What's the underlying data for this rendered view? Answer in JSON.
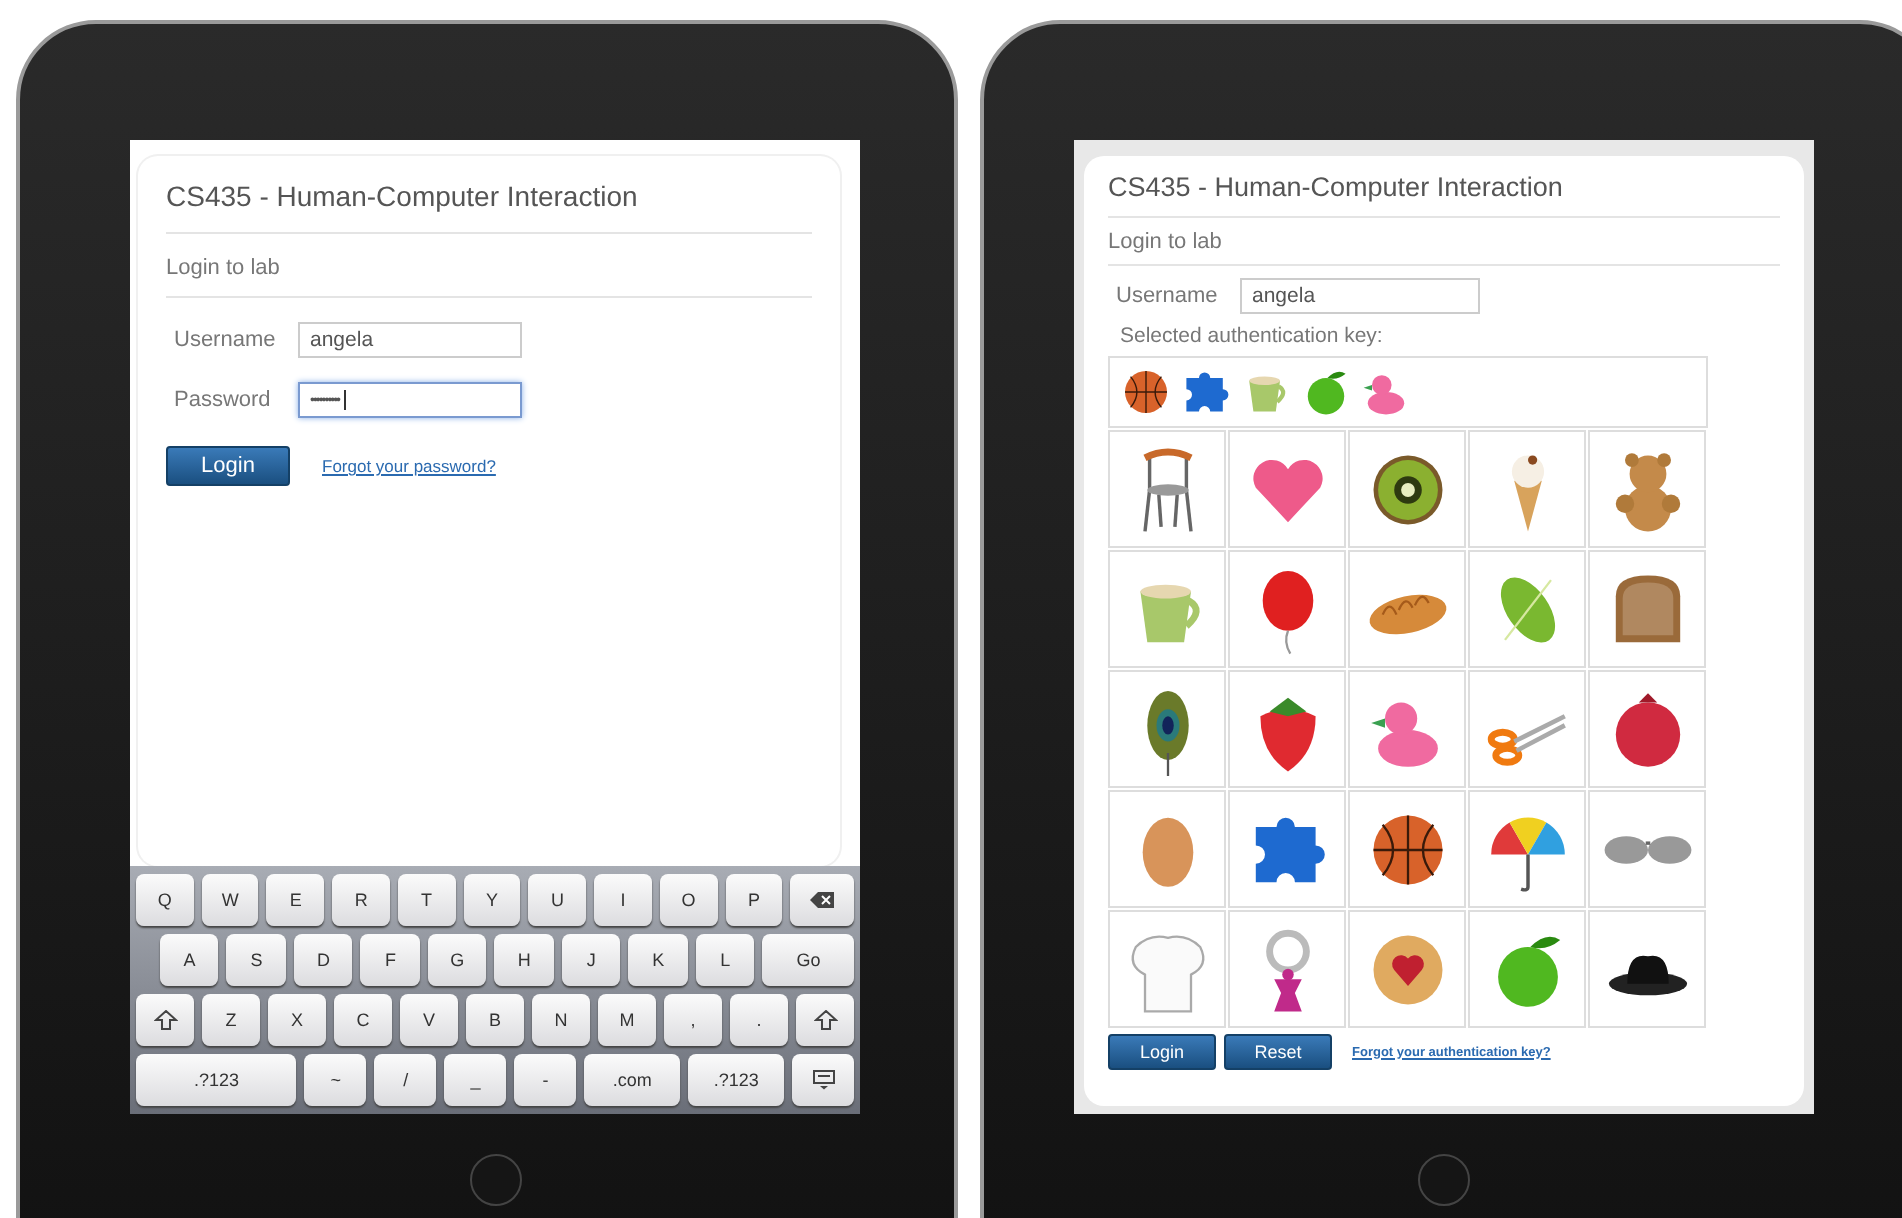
{
  "left_ipad": {
    "course_title": "CS435 - Human-Computer Interaction",
    "section_title": "Login to lab",
    "username": {
      "label": "Username",
      "value": "angela",
      "focused": false
    },
    "password": {
      "label": "Password",
      "value": "••••••••••",
      "focused": true
    },
    "login_button": "Login",
    "forgot_link": "Forgot your password?",
    "keyboard": [
      [
        {
          "kind": "key",
          "label": "Q"
        },
        {
          "kind": "key",
          "label": "W"
        },
        {
          "kind": "key",
          "label": "E"
        },
        {
          "kind": "key",
          "label": "R"
        },
        {
          "kind": "key",
          "label": "T"
        },
        {
          "kind": "key",
          "label": "Y"
        },
        {
          "kind": "key",
          "label": "U"
        },
        {
          "kind": "key",
          "label": "I"
        },
        {
          "kind": "key",
          "label": "O"
        },
        {
          "kind": "key",
          "label": "P"
        },
        {
          "kind": "backspace"
        }
      ],
      [
        {
          "kind": "key",
          "label": "A"
        },
        {
          "kind": "key",
          "label": "S"
        },
        {
          "kind": "key",
          "label": "D"
        },
        {
          "kind": "key",
          "label": "F"
        },
        {
          "kind": "key",
          "label": "G"
        },
        {
          "kind": "key",
          "label": "H"
        },
        {
          "kind": "key",
          "label": "J"
        },
        {
          "kind": "key",
          "label": "K"
        },
        {
          "kind": "key",
          "label": "L"
        },
        {
          "kind": "wide",
          "label": "Go"
        }
      ],
      [
        {
          "kind": "shift"
        },
        {
          "kind": "key",
          "label": "Z"
        },
        {
          "kind": "key",
          "label": "X"
        },
        {
          "kind": "key",
          "label": "C"
        },
        {
          "kind": "key",
          "label": "V"
        },
        {
          "kind": "key",
          "label": "B"
        },
        {
          "kind": "key",
          "label": "N"
        },
        {
          "kind": "key",
          "label": "M"
        },
        {
          "kind": "key",
          "label": ","
        },
        {
          "kind": "key",
          "label": "."
        },
        {
          "kind": "shift"
        }
      ],
      [
        {
          "kind": "space",
          "label": ".?123"
        },
        {
          "kind": "key",
          "label": "~"
        },
        {
          "kind": "key",
          "label": "/"
        },
        {
          "kind": "key",
          "label": "_"
        },
        {
          "kind": "key",
          "label": "-"
        },
        {
          "kind": "wide",
          "label": ".com"
        },
        {
          "kind": "wide",
          "label": ".?123"
        },
        {
          "kind": "hide"
        }
      ]
    ]
  },
  "right_ipad": {
    "course_title": "CS435 - Human-Computer Interaction",
    "section_title": "Login to lab",
    "username": {
      "label": "Username",
      "value": "angela"
    },
    "key_label": "Selected authentication key:",
    "buttons": [
      "Login",
      "Reset"
    ],
    "forgot_link": "Forgot your authentication key?"
  }
}
